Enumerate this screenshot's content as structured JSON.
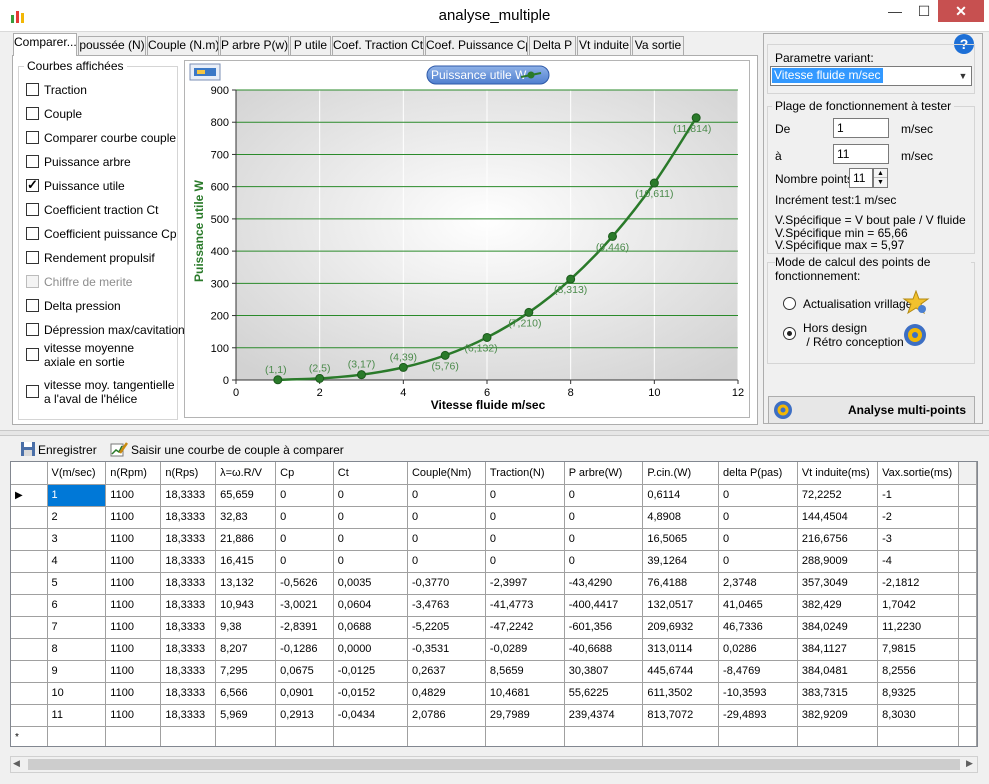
{
  "window": {
    "title": "analyse_multiple",
    "minimize": "—",
    "maximize": "☐",
    "close": "✕"
  },
  "tabs": [
    "Comparer...",
    "poussée (N)",
    "Couple (N.m)",
    "P arbre P(w)",
    "P utile",
    "Coef. Traction Ct",
    "Coef. Puissance Cp",
    "Delta P",
    "Vt induite",
    "Va sortie"
  ],
  "curves_group": {
    "title": "Courbes affichées",
    "items": [
      {
        "label": "Traction",
        "checked": false,
        "enabled": true
      },
      {
        "label": "Couple",
        "checked": false,
        "enabled": true
      },
      {
        "label": "Comparer courbe couple",
        "checked": false,
        "enabled": true
      },
      {
        "label": "Puissance arbre",
        "checked": false,
        "enabled": true
      },
      {
        "label": "Puissance utile",
        "checked": true,
        "enabled": true
      },
      {
        "label": "Coefficient traction Ct",
        "checked": false,
        "enabled": true
      },
      {
        "label": "Coefficient puissance Cp",
        "checked": false,
        "enabled": true
      },
      {
        "label": "Rendement propulsif",
        "checked": false,
        "enabled": true
      },
      {
        "label": "Chiffre de merite",
        "checked": false,
        "enabled": false
      },
      {
        "label": "Delta pression",
        "checked": false,
        "enabled": true
      },
      {
        "label": "Dépression max/cavitation",
        "checked": false,
        "enabled": true
      },
      {
        "label": "vitesse moyenne\naxiale en sortie",
        "checked": false,
        "enabled": true
      },
      {
        "label": "vitesse moy. tangentielle\na l'aval de l'hélice",
        "checked": false,
        "enabled": true
      }
    ]
  },
  "chart_data": {
    "type": "line",
    "legend": "Puissance utile W",
    "xlabel": "Vitesse fluide m/sec",
    "ylabel": "Puissance utile W",
    "xlim": [
      0,
      12
    ],
    "ylim": [
      0,
      900
    ],
    "xticks": [
      0,
      2,
      4,
      6,
      8,
      10,
      12
    ],
    "yticks": [
      0,
      100,
      200,
      300,
      400,
      500,
      600,
      700,
      800,
      900
    ],
    "grid": "horizontal",
    "series": [
      {
        "name": "Puissance utile W",
        "color": "#2a7a2a",
        "x": [
          1,
          2,
          3,
          4,
          5,
          6,
          7,
          8,
          9,
          10,
          11
        ],
        "y": [
          0.6114,
          4.8908,
          16.5065,
          39.1264,
          76.4188,
          132.0517,
          209.6932,
          313.0114,
          445.6744,
          611.3502,
          813.7072
        ],
        "labels": [
          "(1,1)",
          "(2,5)",
          "(3,17)",
          "(4,39)",
          "(5,76)",
          "(6,132)",
          "(7,210)",
          "(8,313)",
          "(9,446)",
          "(10,611)",
          "(11,814)"
        ]
      }
    ]
  },
  "right_panel": {
    "parametre_label": "Parametre variant:",
    "parametre_value": "Vitesse fluide m/sec",
    "plage_title": "Plage de fonctionnement à tester",
    "de_label": "De",
    "de_value": "1",
    "de_unit": "m/sec",
    "a_label": "à",
    "a_value": "11",
    "a_unit": "m/sec",
    "nb_points_label": "Nombre points",
    "nb_points_value": "11",
    "increment": "Incrément test:1 m/sec",
    "vspec_def": "V.Spécifique = V bout pale / V fluide",
    "vspec_min": "V.Spécifique min =  65,66",
    "vspec_max": "V.Spécifique max =  5,97",
    "mode_title": "Mode de calcul des points de fonctionnement:",
    "mode_options": [
      {
        "label": "Actualisation vrillage",
        "selected": false
      },
      {
        "label": "Hors design\n / Rétro conception",
        "selected": true
      }
    ],
    "analyse_button": "Analyse multi-points",
    "help": "?"
  },
  "toolbar": {
    "save": "Enregistrer",
    "compare": "Saisir une courbe de couple à comparer"
  },
  "table": {
    "columns": [
      "V(m/sec)",
      "n(Rpm)",
      "n(Rps)",
      "λ=ω.R/V",
      "Cp",
      "Ct",
      "Couple(Nm)",
      "Traction(N)",
      "P arbre(W)",
      "P.cin.(W)",
      "delta P(pas)",
      "Vt induite(ms)",
      "Vax.sortie(ms)"
    ],
    "rows": [
      [
        "1",
        "1100",
        "18,3333",
        "65,659",
        "0",
        "0",
        "0",
        "0",
        "0",
        "0,6114",
        "0",
        "72,2252",
        "-1"
      ],
      [
        "2",
        "1100",
        "18,3333",
        "32,83",
        "0",
        "0",
        "0",
        "0",
        "0",
        "4,8908",
        "0",
        "144,4504",
        "-2"
      ],
      [
        "3",
        "1100",
        "18,3333",
        "21,886",
        "0",
        "0",
        "0",
        "0",
        "0",
        "16,5065",
        "0",
        "216,6756",
        "-3"
      ],
      [
        "4",
        "1100",
        "18,3333",
        "16,415",
        "0",
        "0",
        "0",
        "0",
        "0",
        "39,1264",
        "0",
        "288,9009",
        "-4"
      ],
      [
        "5",
        "1100",
        "18,3333",
        "13,132",
        "-0,5626",
        "0,0035",
        "-0,3770",
        "-2,3997",
        "-43,4290",
        "76,4188",
        "2,3748",
        "357,3049",
        "-2,1812"
      ],
      [
        "6",
        "1100",
        "18,3333",
        "10,943",
        "-3,0021",
        "0,0604",
        "-3,4763",
        "-41,4773",
        "-400,4417",
        "132,0517",
        "41,0465",
        "382,429",
        "1,7042"
      ],
      [
        "7",
        "1100",
        "18,3333",
        "9,38",
        "-2,8391",
        "0,0688",
        "-5,2205",
        "-47,2242",
        "-601,356",
        "209,6932",
        "46,7336",
        "384,0249",
        "11,2230"
      ],
      [
        "8",
        "1100",
        "18,3333",
        "8,207",
        "-0,1286",
        "0,0000",
        "-0,3531",
        "-0,0289",
        "-40,6688",
        "313,0114",
        "0,0286",
        "384,1127",
        "7,9815"
      ],
      [
        "9",
        "1100",
        "18,3333",
        "7,295",
        "0,0675",
        "-0,0125",
        "0,2637",
        "8,5659",
        "30,3807",
        "445,6744",
        "-8,4769",
        "384,0481",
        "8,2556"
      ],
      [
        "10",
        "1100",
        "18,3333",
        "6,566",
        "0,0901",
        "-0,0152",
        "0,4829",
        "10,4681",
        "55,6225",
        "611,3502",
        "-10,3593",
        "383,7315",
        "8,9325"
      ],
      [
        "11",
        "1100",
        "18,3333",
        "5,969",
        "0,2913",
        "-0,0434",
        "2,0786",
        "29,7989",
        "239,4374",
        "813,7072",
        "-29,4893",
        "382,9209",
        "8,3030"
      ]
    ],
    "selected_row": 0,
    "new_row_marker": "*",
    "current_row_marker": "▶"
  }
}
